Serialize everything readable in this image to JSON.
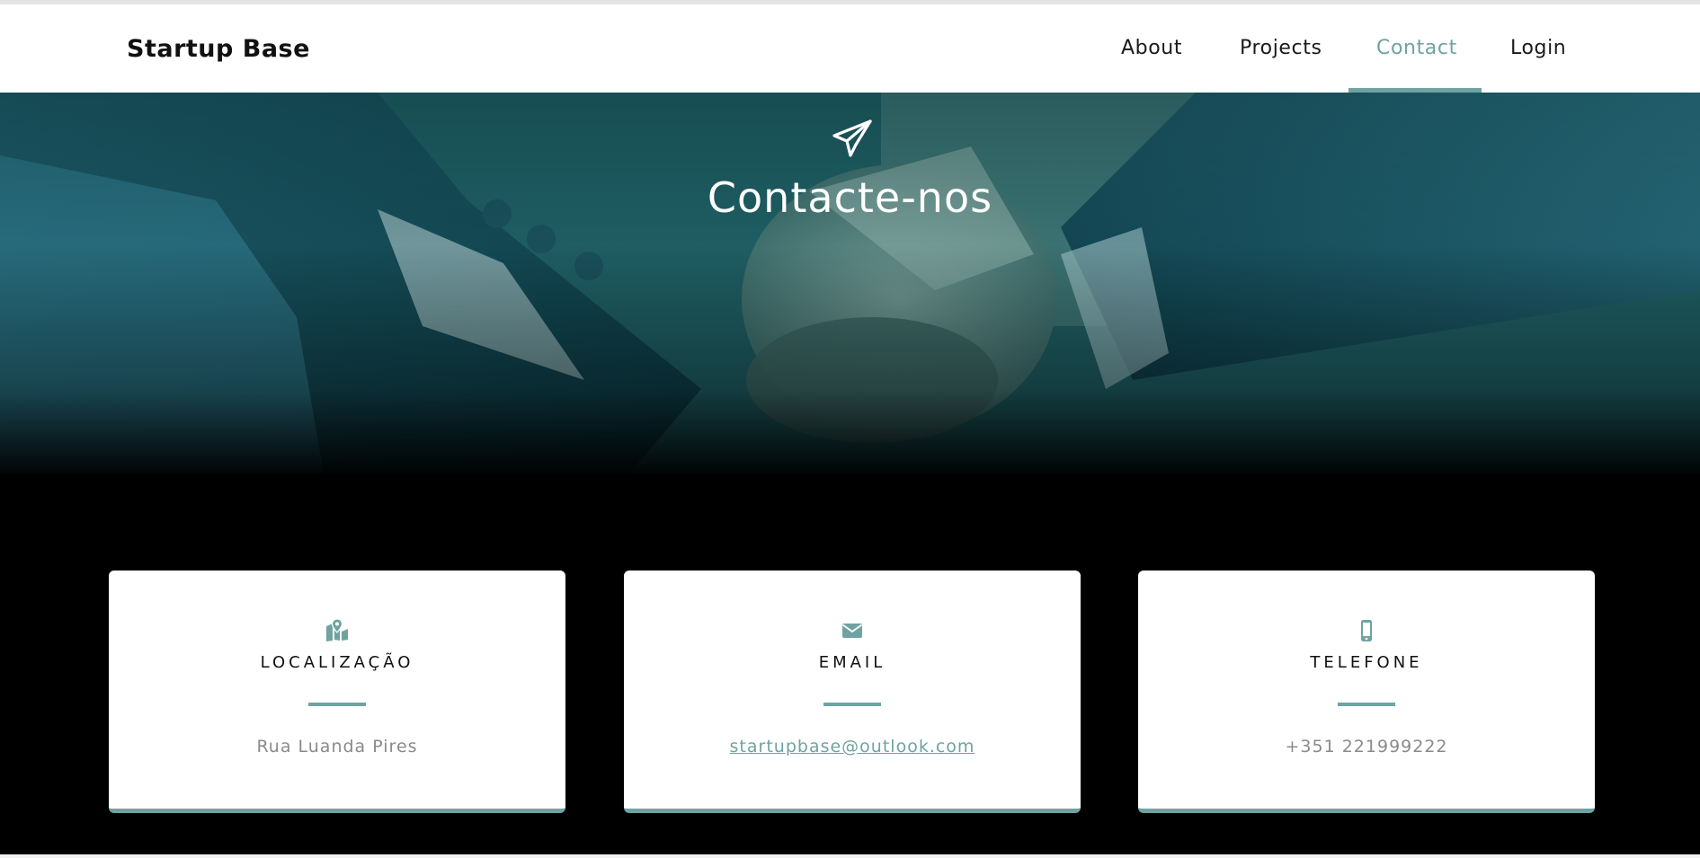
{
  "header": {
    "brand": "Startup Base",
    "nav": [
      {
        "label": "About",
        "active": false
      },
      {
        "label": "Projects",
        "active": false
      },
      {
        "label": "Contact",
        "active": true
      },
      {
        "label": "Login",
        "active": false
      }
    ]
  },
  "hero": {
    "icon": "paper-plane-icon",
    "title": "Contacte-nos"
  },
  "cards": [
    {
      "icon": "map-marker-icon",
      "title": "LOCALIZAÇÃO",
      "value": "Rua Luanda Pires"
    },
    {
      "icon": "envelope-icon",
      "title": "EMAIL",
      "value": "startupbase@outlook.com"
    },
    {
      "icon": "mobile-phone-icon",
      "title": "TELEFONE",
      "value": "+351 221999222"
    }
  ],
  "colors": {
    "accent": "#6fa3a1",
    "page_background": "#000000",
    "navbar_background": "#ffffff"
  }
}
